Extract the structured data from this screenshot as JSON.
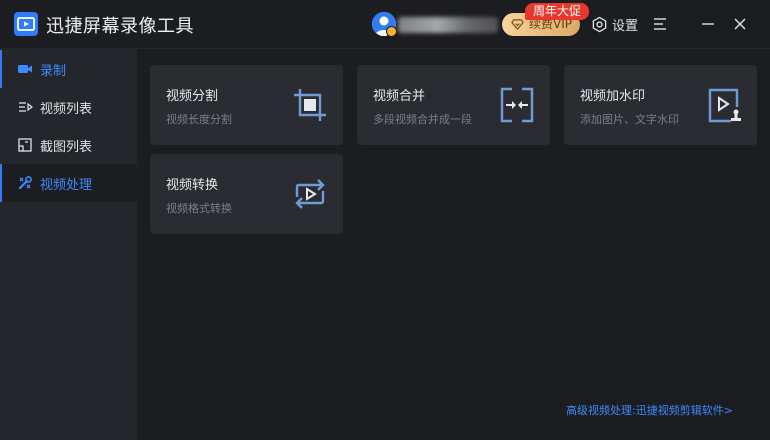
{
  "app": {
    "title": "迅捷屏幕录像工具"
  },
  "header": {
    "vip_label": "续费VIP",
    "promo_label": "周年大促",
    "settings_label": "设置"
  },
  "sidebar": {
    "items": [
      {
        "label": "录制",
        "icon": "camera-icon"
      },
      {
        "label": "视频列表",
        "icon": "list-icon"
      },
      {
        "label": "截图列表",
        "icon": "screenshot-icon"
      },
      {
        "label": "视频处理",
        "icon": "tools-icon"
      }
    ]
  },
  "cards": [
    {
      "title": "视频分割",
      "desc": "视频长度分割",
      "icon": "crop-icon"
    },
    {
      "title": "视频合并",
      "desc": "多段视频合并成一段",
      "icon": "merge-icon"
    },
    {
      "title": "视频加水印",
      "desc": "添加图片、文字水印",
      "icon": "watermark-icon"
    },
    {
      "title": "视频转换",
      "desc": "视频格式转换",
      "icon": "convert-icon"
    }
  ],
  "footer": {
    "link_label": "高级视频处理:迅捷视频剪辑软件>"
  },
  "colors": {
    "accent": "#2f7cf6",
    "link": "#3d8bff",
    "promo": "#e8372c",
    "vip_gold": "#d9a964",
    "icon_blue": "#6f9bd6"
  }
}
